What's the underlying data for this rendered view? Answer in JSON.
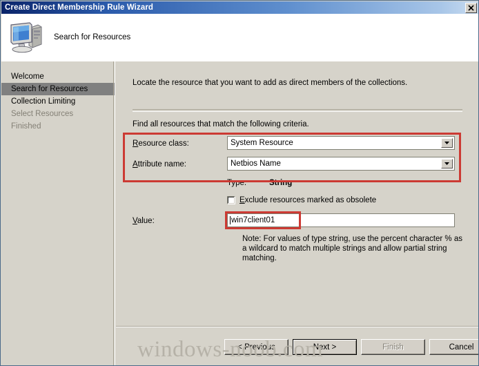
{
  "window": {
    "title": "Create Direct Membership Rule Wizard",
    "close_icon": "close-icon"
  },
  "header": {
    "title": "Search for Resources",
    "icon": "computer-icon"
  },
  "sidebar": {
    "items": [
      {
        "label": "Welcome",
        "state": "enabled"
      },
      {
        "label": "Search for Resources",
        "state": "selected"
      },
      {
        "label": "Collection Limiting",
        "state": "enabled"
      },
      {
        "label": "Select Resources",
        "state": "disabled"
      },
      {
        "label": "Finished",
        "state": "disabled"
      }
    ]
  },
  "content": {
    "intro": "Locate the resource that you want to add as direct members of the collections.",
    "criteria_heading": "Find all resources that match the following criteria.",
    "resource_class": {
      "label_prefix": "",
      "label_accel": "R",
      "label_rest": "esource class:",
      "label": "Resource class:",
      "value": "System Resource",
      "arrow_icon": "chevron-down-icon"
    },
    "attribute_name": {
      "label_accel": "A",
      "label_rest": "ttribute name:",
      "label": "Attribute name:",
      "value": "Netbios Name",
      "arrow_icon": "chevron-down-icon"
    },
    "type": {
      "label": "Type:",
      "value": "String"
    },
    "exclude_obsolete": {
      "label_accel": "E",
      "label_rest": "xclude resources marked as obsolete",
      "label": "Exclude resources marked as obsolete",
      "checked": false
    },
    "value_field": {
      "label_accel": "V",
      "label_rest": "alue:",
      "label": "Value:",
      "value": "win7client01"
    },
    "note": "Note: For values of type string, use the percent character % as a wildcard to match multiple strings and allow partial string matching."
  },
  "buttons": {
    "previous": {
      "label": "< Previous",
      "state": "enabled"
    },
    "next": {
      "label": "Next >",
      "state": "default"
    },
    "finish": {
      "label": "Finish",
      "state": "disabled"
    },
    "cancel": {
      "label": "Cancel",
      "state": "enabled"
    }
  },
  "watermark": "windows-noob.com",
  "colors": {
    "dialog_face": "#d6d3ca",
    "title_gradient_start": "#0a246a",
    "title_gradient_end": "#c9dcf0",
    "selection": "#808080",
    "annotation_red": "#cc3a33",
    "disabled_text": "#848076"
  }
}
